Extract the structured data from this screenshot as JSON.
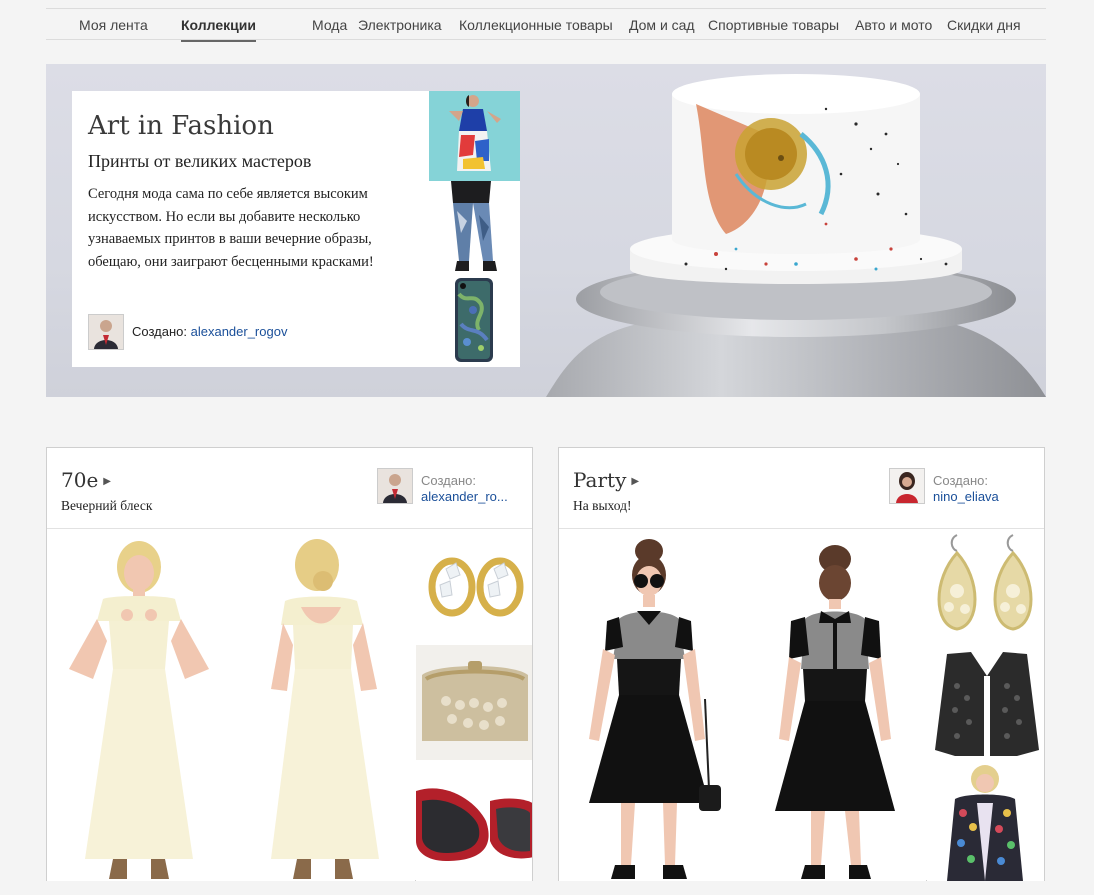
{
  "nav": {
    "items": [
      {
        "label": "Моя лента",
        "active": false
      },
      {
        "label": "Коллекции",
        "active": true
      },
      {
        "label": "Мода",
        "active": false
      },
      {
        "label": "Электроника",
        "active": false
      },
      {
        "label": "Коллекционные товары",
        "active": false
      },
      {
        "label": "Дом и сад",
        "active": false
      },
      {
        "label": "Спортивные товары",
        "active": false
      },
      {
        "label": "Авто и мото",
        "active": false
      },
      {
        "label": "Скидки дня",
        "active": false
      }
    ]
  },
  "hero": {
    "title": "Art in Fashion",
    "subtitle": "Принты от великих мастеров",
    "description": "Сегодня мода сама по себе является высоким искусством. Но если вы добавите несколько узнаваемых принтов в ваши вечерние образы, обещаю, они заиграют бесценными красками!",
    "created_label": "Создано:",
    "author": "alexander_rogov"
  },
  "collections": [
    {
      "title": "70е",
      "subtitle": "Вечерний блеск",
      "created_label": "Создано:",
      "author": "alexander_ro..."
    },
    {
      "title": "Party",
      "subtitle": "На выход!",
      "created_label": "Создано:",
      "author": "nino_eliava"
    }
  ],
  "colors": {
    "link": "#1a4f99",
    "page_bg": "#f4f4f4",
    "hero_bg": "#d8dae3"
  }
}
